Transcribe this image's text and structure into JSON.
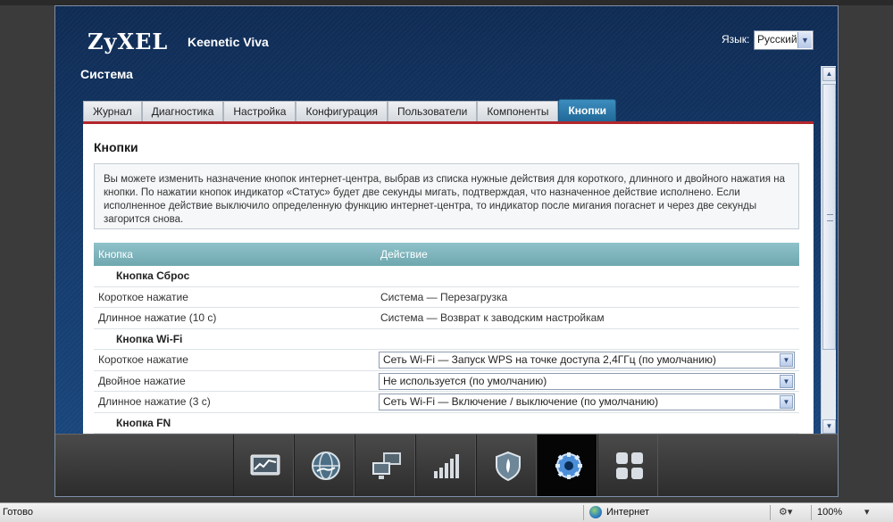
{
  "header": {
    "brand": "ZyXEL",
    "model": "Keenetic Viva",
    "language_label": "Язык:",
    "language_value": "Русский",
    "section_title": "Система"
  },
  "tabs": [
    {
      "label": "Журнал",
      "active": false
    },
    {
      "label": "Диагностика",
      "active": false
    },
    {
      "label": "Настройка",
      "active": false
    },
    {
      "label": "Конфигурация",
      "active": false
    },
    {
      "label": "Пользователи",
      "active": false
    },
    {
      "label": "Компоненты",
      "active": false
    },
    {
      "label": "Кнопки",
      "active": true
    }
  ],
  "content": {
    "title": "Кнопки",
    "info": "Вы можете изменить назначение кнопок интернет-центра, выбрав из списка нужные действия для короткого, длинного и двойного нажатия на кнопки. По нажатии кнопок индикатор «Статус» будет две секунды мигать, подтверждая, что назначенное действие исполнено. Если исполненное действие выключило определенную функцию интернет-центра, то индикатор после мигания погаснет и через две секунды загорится снова.",
    "table": {
      "col_button": "Кнопка",
      "col_action": "Действие",
      "groups": [
        {
          "name": "Кнопка Сброс",
          "rows": [
            {
              "press": "Короткое нажатие",
              "action": "Система — Перезагрузка"
            },
            {
              "press": "Длинное нажатие (10 с)",
              "action": "Система — Возврат к заводским настройкам"
            }
          ]
        },
        {
          "name": "Кнопка Wi-Fi",
          "rows": [
            {
              "press": "Короткое нажатие",
              "action": "Сеть Wi-Fi — Запуск WPS на точке доступа 2,4ГГц (по умолчанию)"
            },
            {
              "press": "Двойное нажатие",
              "action": "Не используется (по умолчанию)"
            },
            {
              "press": "Длинное нажатие (3 с)",
              "action": "Сеть Wi-Fi — Включение / выключение (по умолчанию)"
            }
          ]
        },
        {
          "name": "Кнопка FN",
          "rows": []
        }
      ]
    }
  },
  "dock": [
    {
      "icon": "monitor-chart-icon",
      "active": false
    },
    {
      "icon": "globe-icon",
      "active": false
    },
    {
      "icon": "network-computers-icon",
      "active": false
    },
    {
      "icon": "signal-bars-icon",
      "active": false
    },
    {
      "icon": "shield-icon",
      "active": false
    },
    {
      "icon": "gear-icon",
      "active": true
    },
    {
      "icon": "apps-grid-icon",
      "active": false
    }
  ],
  "statusbar": {
    "left": "Готово",
    "zone": "Интернет",
    "zoom": "100%"
  },
  "colors": {
    "accent_tab": "#1f6796",
    "tab_underline": "#b3272c",
    "table_header": "#7fb5bc"
  }
}
